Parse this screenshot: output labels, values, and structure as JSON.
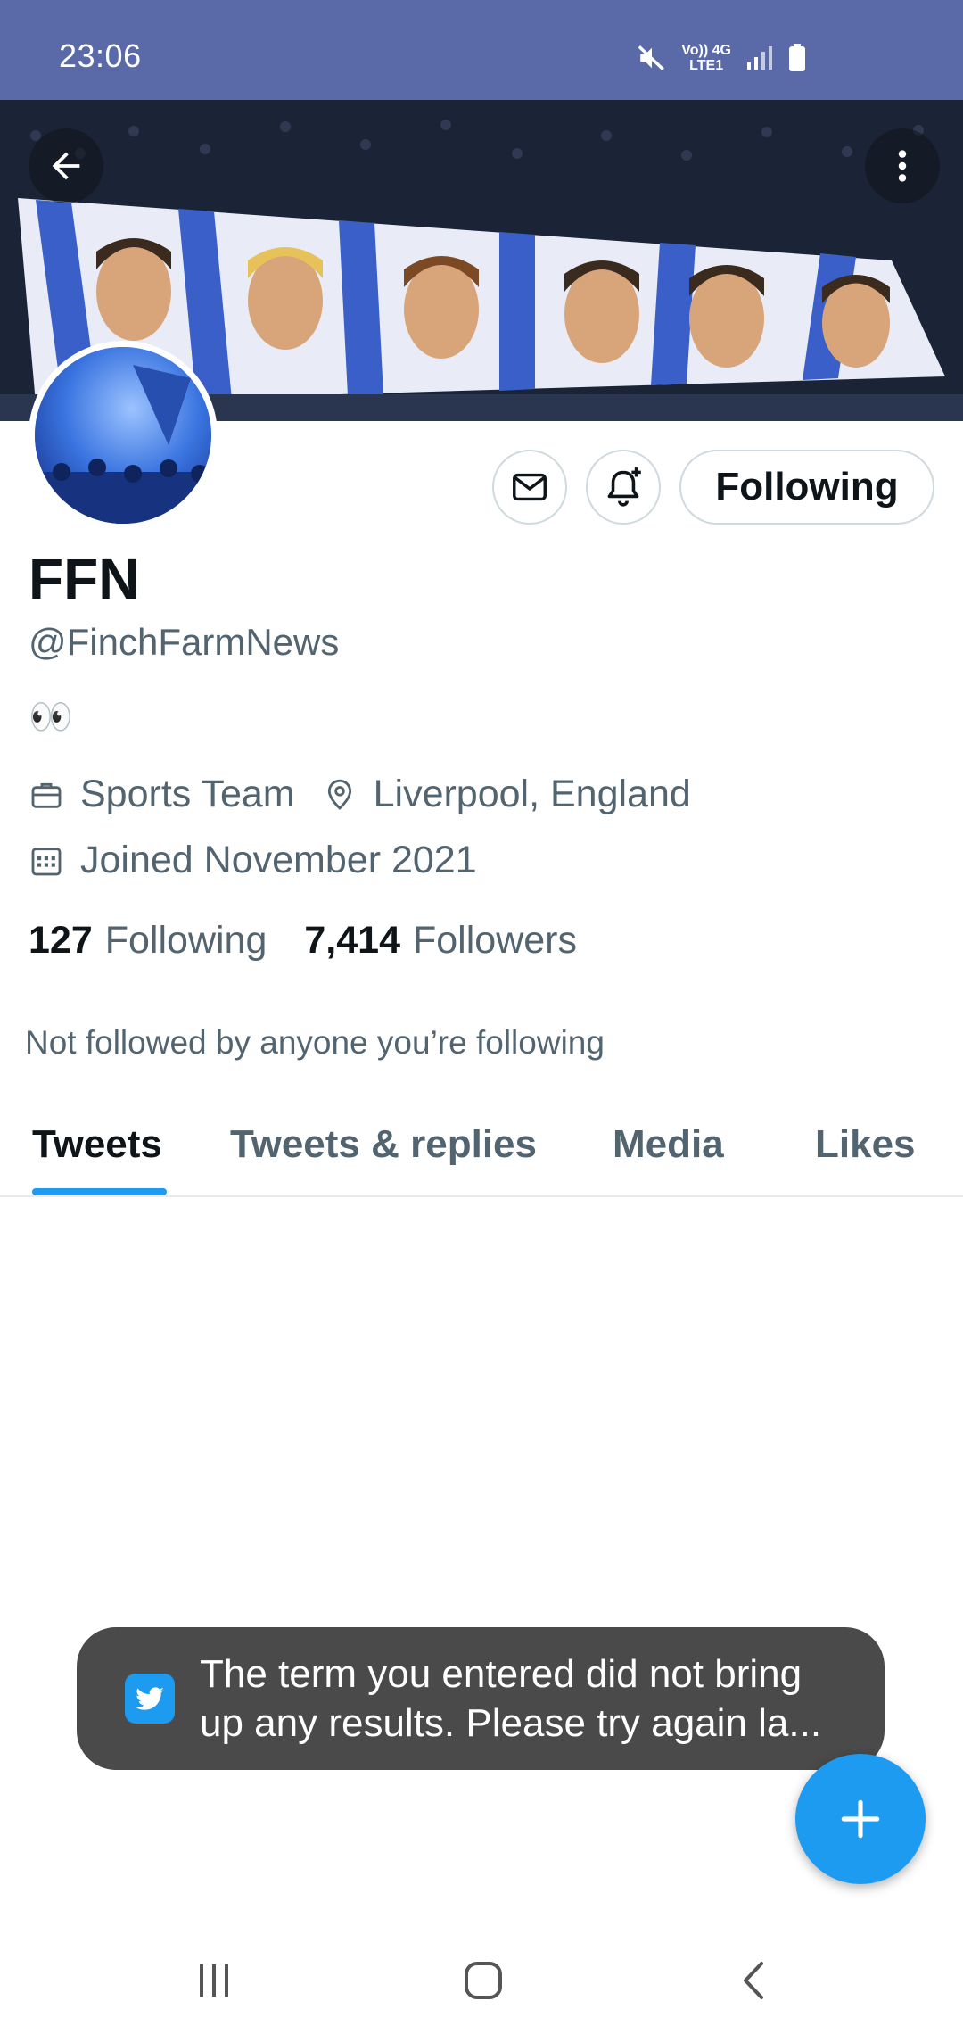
{
  "status_bar": {
    "time": "23:06",
    "network_line1": "Vo)) 4G",
    "network_line2": "LTE1",
    "icons": [
      "mute-icon",
      "signal-icon",
      "battery-icon"
    ]
  },
  "header": {
    "back_icon": "back-arrow-icon",
    "more_icon": "more-vertical-icon"
  },
  "profile": {
    "display_name": "FFN",
    "handle": "@FinchFarmNews",
    "bio": "👀",
    "category": "Sports Team",
    "location": "Liverpool, England",
    "joined": "Joined November 2021",
    "following_count": "127",
    "following_label": "Following",
    "followers_count": "7,414",
    "followers_label": "Followers",
    "not_followed_text": "Not followed by anyone you’re following"
  },
  "actions": {
    "message_icon": "mail-icon",
    "notify_icon": "bell-plus-icon",
    "following_button": "Following"
  },
  "tabs": [
    {
      "label": "Tweets",
      "active": true
    },
    {
      "label": "Tweets & replies",
      "active": false
    },
    {
      "label": "Media",
      "active": false
    },
    {
      "label": "Likes",
      "active": false
    }
  ],
  "toast": {
    "icon": "twitter-bird-icon",
    "text": "The term you entered did not bring up any results. Please try again la..."
  },
  "fab": {
    "icon": "plus-icon"
  },
  "nav_bar": {
    "icons": [
      "recents-icon",
      "home-icon",
      "back-icon"
    ]
  },
  "colors": {
    "status_bar": "#5a6aa8",
    "accent": "#1d9bf0",
    "text_primary": "#0f1419",
    "text_secondary": "#536471",
    "toast_bg": "#4a4a4a"
  }
}
